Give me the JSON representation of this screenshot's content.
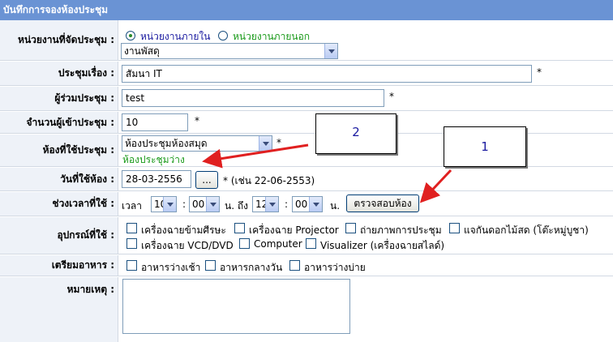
{
  "header": {
    "title": "บันทึกการจองห้องประชุม"
  },
  "form": {
    "unit": {
      "label": "หน่วยงานที่จัดประชุม :",
      "radio_internal": "หน่วยงานภายใน",
      "radio_external": "หน่วยงานภายนอก",
      "selected_radio": "internal",
      "select_value": "งานพัสดุ"
    },
    "topic": {
      "label": "ประชุมเรื่อง :",
      "value": "สัมนา IT",
      "required": "*"
    },
    "participants": {
      "label": "ผู้ร่วมประชุม :",
      "value": "test",
      "required": "*"
    },
    "count": {
      "label": "จำนวนผู้เข้าประชุม :",
      "value": "10",
      "required": "*"
    },
    "room": {
      "label": "ห้องที่ใช้ประชุม :",
      "select_value": "ห้องประชุมห้องสมุด",
      "required": "*",
      "status": "ห้องประชุมว่าง"
    },
    "date": {
      "label": "วันที่ใช้ห้อง :",
      "value": "28-03-2556",
      "picker_label": "...",
      "hint": "* (เช่น 22-06-2553)"
    },
    "time": {
      "label": "ช่วงเวลาที่ใช้ :",
      "prefix": "เวลา",
      "start_hour": "10",
      "start_min": "00",
      "sep1": ":",
      "mid": "น. ถึง",
      "end_hour": "12",
      "end_min": "00",
      "sep2": ":",
      "suffix": "น.",
      "check_button": "ตรวจสอบห้อง"
    },
    "equipment": {
      "label": "อุปกรณ์ที่ใช้ :",
      "items": [
        "เครื่องฉายข้ามศีรษะ",
        "เครื่องฉาย Projector",
        "ถ่ายภาพการประชุม",
        "แจกันดอกไม้สด (โต๊ะหมู่บูชา)",
        "เครื่องฉาย VCD/DVD",
        "Computer",
        "Visualizer (เครื่องฉายสไลด์)"
      ]
    },
    "food": {
      "label": "เตรียมอาหาร :",
      "items": [
        "อาหารว่างเช้า",
        "อาหารกลางวัน",
        "อาหารว่างบ่าย"
      ]
    },
    "remark": {
      "label": "หมายเหตุ :",
      "value": ""
    }
  },
  "annotations": {
    "note1": "1",
    "note2": "2"
  },
  "colors": {
    "header": "#6a93d4",
    "label_bg": "#eef2f8",
    "status_green": "#1a9a1a",
    "arrow": "#e02020"
  }
}
